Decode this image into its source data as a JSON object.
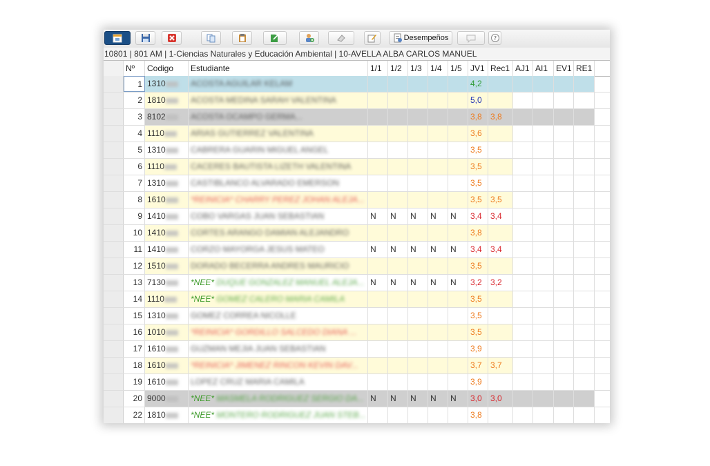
{
  "toolbar": {
    "buttons": [
      {
        "name": "calendar-button",
        "icon": "calendar-icon"
      },
      {
        "name": "save-button",
        "icon": "floppy-icon"
      },
      {
        "name": "cancel-button",
        "icon": "close-icon"
      },
      {
        "name": "copy-button",
        "icon": "copy-icon"
      },
      {
        "name": "paste-button",
        "icon": "clipboard-icon"
      },
      {
        "name": "export-button",
        "icon": "export-icon"
      },
      {
        "name": "add-student-button",
        "icon": "user-add-icon"
      },
      {
        "name": "erase-button",
        "icon": "eraser-icon"
      },
      {
        "name": "edit-button",
        "icon": "edit-icon"
      },
      {
        "name": "desempenos-button",
        "icon": "report-icon",
        "label": "Desempeños"
      },
      {
        "name": "comment-button",
        "icon": "speech-bubble-icon"
      },
      {
        "name": "help-button",
        "icon": "help-icon"
      }
    ]
  },
  "info": "10801 | 801 AM | 1-Ciencias Naturales y Educación Ambiental | 10-AVELLA ALBA CARLOS MANUEL",
  "columns": [
    "Nº",
    "Codigo",
    "Estudiante",
    "1/1",
    "1/2",
    "1/3",
    "1/4",
    "1/5",
    "JV1",
    "Rec1",
    "AJ1",
    "AI1",
    "EV1",
    "RE1"
  ],
  "rows": [
    {
      "n": "1",
      "code": "1310",
      "student": "ACOSTA AGUILAR KELAM",
      "marks": [
        "",
        "",
        "",
        "",
        ""
      ],
      "jv1": "4,2",
      "jv1_color": "green",
      "rec1": "",
      "bg": "#bfdfe9"
    },
    {
      "n": "2",
      "code": "1810",
      "student": "ACOSTA MEDINA SARAH VALENTINA",
      "marks": [
        "",
        "",
        "",
        "",
        ""
      ],
      "jv1": "5,0",
      "jv1_color": "blue",
      "rec1": "",
      "bg": "#fffbd9"
    },
    {
      "n": "3",
      "code": "8102",
      "student": "ACOSTA OCAMPO GERMA...",
      "marks": [
        "",
        "",
        "",
        "",
        ""
      ],
      "jv1": "3,8",
      "jv1_color": "orange",
      "rec1": "3,8",
      "bg": "#cfcfcf"
    },
    {
      "n": "4",
      "code": "1110",
      "student": "ARIAS GUTIERREZ VALENTINA",
      "marks": [
        "",
        "",
        "",
        "",
        ""
      ],
      "jv1": "3,6",
      "jv1_color": "orange",
      "rec1": "",
      "bg": "#fffbd9"
    },
    {
      "n": "5",
      "code": "1310",
      "student": "CABRERA GUARIN MIGUEL ANGEL",
      "marks": [
        "",
        "",
        "",
        "",
        ""
      ],
      "jv1": "3,5",
      "jv1_color": "orange",
      "rec1": "",
      "bg": "#ffffff"
    },
    {
      "n": "6",
      "code": "1110",
      "student": "CACERES BAUTISTA LIZETH VALENTINA",
      "marks": [
        "",
        "",
        "",
        "",
        ""
      ],
      "jv1": "3,5",
      "jv1_color": "orange",
      "rec1": "",
      "bg": "#fffbd9"
    },
    {
      "n": "7",
      "code": "1310",
      "student": "CASTIBLANCO ALVARADO EMERSON",
      "marks": [
        "",
        "",
        "",
        "",
        ""
      ],
      "jv1": "3,5",
      "jv1_color": "orange",
      "rec1": "",
      "bg": "#ffffff"
    },
    {
      "n": "8",
      "code": "1610",
      "student": "*REINICIA* CHARRY PEREZ JOHAN ALEJA...",
      "marks": [
        "",
        "",
        "",
        "",
        ""
      ],
      "jv1": "3,5",
      "jv1_color": "orange",
      "rec1": "3,5",
      "bg": "#fffbd9",
      "tag": "rein"
    },
    {
      "n": "9",
      "code": "1410",
      "student": "COBO VARGAS JUAN SEBASTIAN",
      "marks": [
        "N",
        "N",
        "N",
        "N",
        "N"
      ],
      "jv1": "3,4",
      "jv1_color": "red",
      "rec1": "3,4",
      "bg": "#ffffff"
    },
    {
      "n": "10",
      "code": "1410",
      "student": "CORTES ARANGO DAMIAN ALEJANDRO",
      "marks": [
        "",
        "",
        "",
        "",
        ""
      ],
      "jv1": "3,8",
      "jv1_color": "orange",
      "rec1": "",
      "bg": "#fffbd9"
    },
    {
      "n": "11",
      "code": "1410",
      "student": "CORZO MAYORGA JESUS MATEO",
      "marks": [
        "N",
        "N",
        "N",
        "N",
        "N"
      ],
      "jv1": "3,4",
      "jv1_color": "red",
      "rec1": "3,4",
      "bg": "#ffffff"
    },
    {
      "n": "12",
      "code": "1510",
      "student": "DORADO BECERRA ANDRES MAURICIO",
      "marks": [
        "",
        "",
        "",
        "",
        ""
      ],
      "jv1": "3,5",
      "jv1_color": "orange",
      "rec1": "",
      "bg": "#fffbd9"
    },
    {
      "n": "13",
      "code": "7130",
      "student": "*NEE* DUQUE GONZALEZ MANUEL ALEJA...",
      "marks": [
        "N",
        "N",
        "N",
        "N",
        "N"
      ],
      "jv1": "3,2",
      "jv1_color": "red",
      "rec1": "3,2",
      "bg": "#ffffff",
      "tag": "nee"
    },
    {
      "n": "14",
      "code": "1110",
      "student": "*NEE* GOMEZ CALERO MARIA CAMILA",
      "marks": [
        "",
        "",
        "",
        "",
        ""
      ],
      "jv1": "3,5",
      "jv1_color": "orange",
      "rec1": "",
      "bg": "#fffbd9",
      "tag": "nee"
    },
    {
      "n": "15",
      "code": "1310",
      "student": "GOMEZ CORREA NICOLLE",
      "marks": [
        "",
        "",
        "",
        "",
        ""
      ],
      "jv1": "3,5",
      "jv1_color": "orange",
      "rec1": "",
      "bg": "#ffffff"
    },
    {
      "n": "16",
      "code": "1010",
      "student": "*REINICIA* GORDILLO SALCEDO DIANA ...",
      "marks": [
        "",
        "",
        "",
        "",
        ""
      ],
      "jv1": "3,5",
      "jv1_color": "orange",
      "rec1": "",
      "bg": "#fffbd9",
      "tag": "rein"
    },
    {
      "n": "17",
      "code": "1610",
      "student": "GUZMAN MEJIA JUAN SEBASTIAN",
      "marks": [
        "",
        "",
        "",
        "",
        ""
      ],
      "jv1": "3,9",
      "jv1_color": "orange",
      "rec1": "",
      "bg": "#ffffff"
    },
    {
      "n": "18",
      "code": "1610",
      "student": "*REINICIA* JIMENEZ RINCON KEVIN DAV...",
      "marks": [
        "",
        "",
        "",
        "",
        ""
      ],
      "jv1": "3,7",
      "jv1_color": "orange",
      "rec1": "3,7",
      "bg": "#fffbd9",
      "tag": "rein"
    },
    {
      "n": "19",
      "code": "1610",
      "student": "LOPEZ CRUZ MARIA CAMILA",
      "marks": [
        "",
        "",
        "",
        "",
        ""
      ],
      "jv1": "3,9",
      "jv1_color": "orange",
      "rec1": "",
      "bg": "#ffffff"
    },
    {
      "n": "20",
      "code": "9000",
      "student": "*NEE* MASMELA RODRIGUEZ SERGIO DA...",
      "marks": [
        "N",
        "N",
        "N",
        "N",
        "N"
      ],
      "jv1": "3,0",
      "jv1_color": "red",
      "rec1": "3,0",
      "bg": "#cfcfcf",
      "tag": "nee"
    },
    {
      "n": "22",
      "code": "1810",
      "student": "*NEE* MONTERO RODRIGUEZ JUAN STEB...",
      "marks": [
        "",
        "",
        "",
        "",
        ""
      ],
      "jv1": "3,8",
      "jv1_color": "orange",
      "rec1": "",
      "bg": "#ffffff",
      "tag": "nee"
    }
  ],
  "colors": {
    "orange": "#ee7a1c",
    "red": "#d8232a",
    "blue": "#1d2fb5",
    "green": "#2e9a33"
  }
}
